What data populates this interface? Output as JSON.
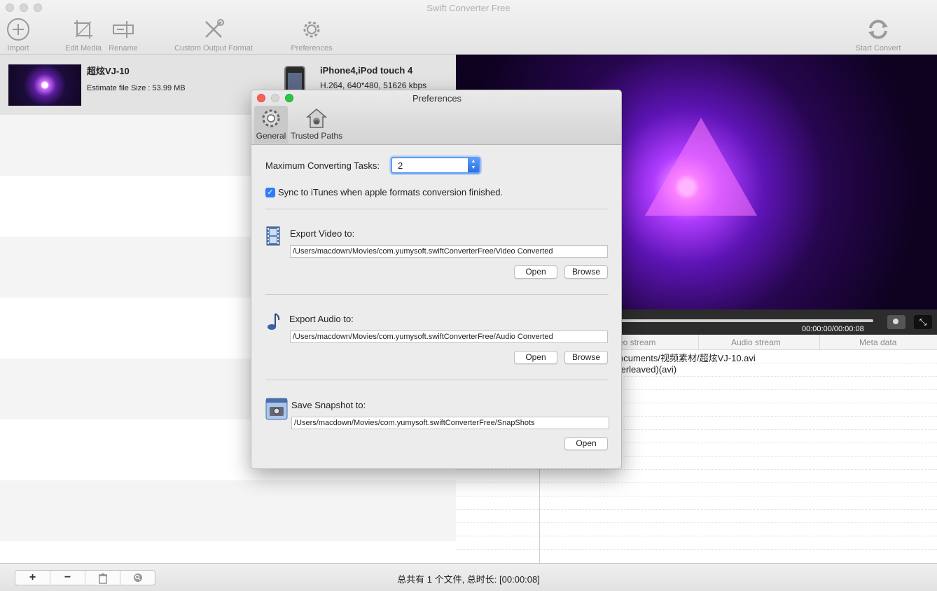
{
  "app": {
    "title": "Swift Converter Free"
  },
  "toolbar": {
    "import": "Import",
    "edit_media": "Edit Media",
    "rename": "Rename",
    "custom_output_format": "Custom Output Format",
    "preferences": "Preferences",
    "start_convert": "Start Convert"
  },
  "file_list": {
    "item": {
      "title": "超炫VJ-10",
      "estimate": "Estimate file Size : 53.99 MB",
      "device_name": "iPhone4,iPod touch 4",
      "device_spec": "H.264, 640*480, 51626 kbps"
    }
  },
  "player": {
    "time": "00:00:00/00:00:08"
  },
  "info_table": {
    "headers": [
      "eo stream",
      "Audio stream",
      "Meta data"
    ],
    "rows": [
      "ocuments/视频素材/超炫VJ-10.avi",
      "terleaved)(avi)"
    ]
  },
  "bottom": {
    "add": "+",
    "remove": "−",
    "status": "总共有 1 个文件, 总时长: [00:00:08]"
  },
  "preferences": {
    "title": "Preferences",
    "tabs": {
      "general": "General",
      "trusted_paths": "Trusted Paths"
    },
    "max_tasks_label": "Maximum Converting Tasks:",
    "max_tasks_value": "2",
    "sync_label": "Sync to iTunes when apple formats conversion finished.",
    "export_video_label": "Export Video to:",
    "export_video_path": "/Users/macdown/Movies/com.yumysoft.swiftConverterFree/Video Converted",
    "export_audio_label": "Export Audio to:",
    "export_audio_path": "/Users/macdown/Movies/com.yumysoft.swiftConverterFree/Audio Converted",
    "snapshot_label": "Save Snapshot to:",
    "snapshot_path": "/Users/macdown/Movies/com.yumysoft.swiftConverterFree/SnapShots",
    "open": "Open",
    "browse": "Browse"
  },
  "colors": {
    "accent": "#2f7cf6",
    "close": "#fc5f57",
    "minimize": "#d6d6d6",
    "zoom": "#2ac840"
  }
}
